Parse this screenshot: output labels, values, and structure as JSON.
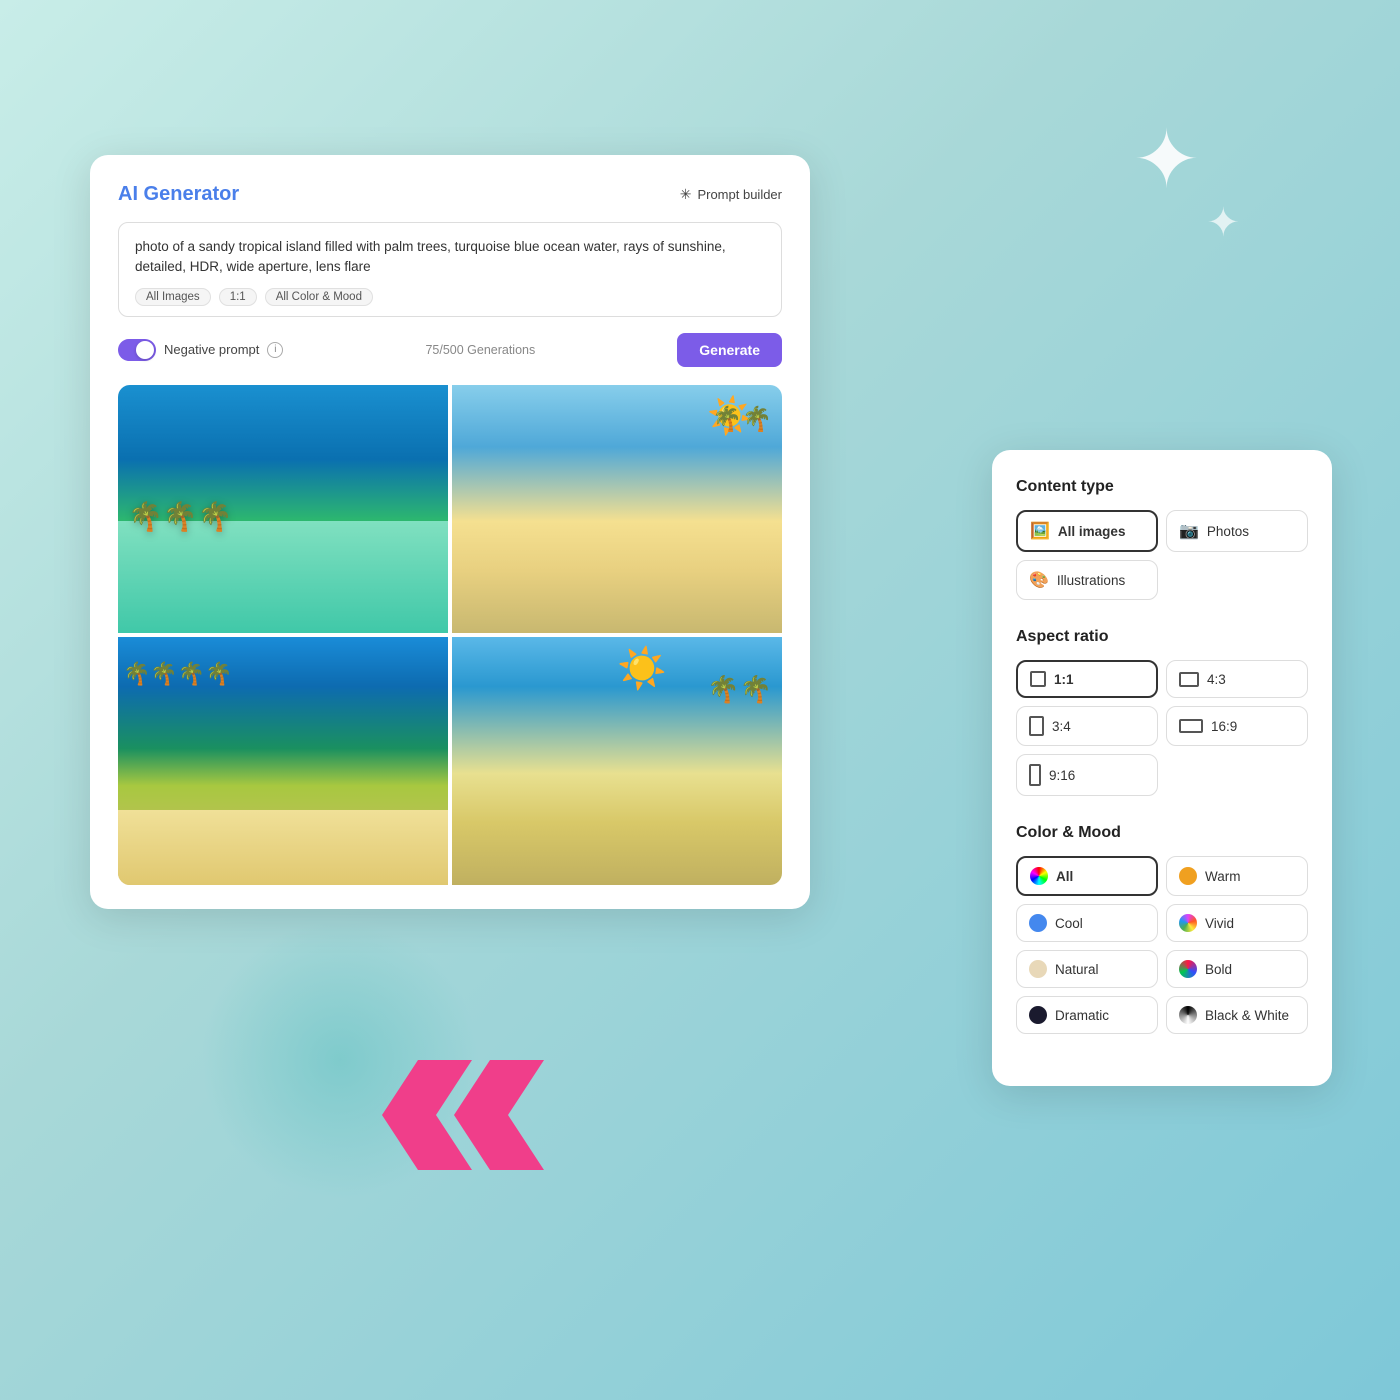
{
  "background": {
    "color_start": "#c8ede8",
    "color_end": "#7ec8d8"
  },
  "generator_card": {
    "title": "AI Generator",
    "prompt_builder_label": "Prompt builder",
    "prompt_text": "photo of a sandy tropical island filled with palm trees, turquoise blue ocean water, rays of sunshine, detailed, HDR, wide aperture, lens flare",
    "tags": [
      "All Images",
      "1:1",
      "All Color & Mood"
    ],
    "negative_prompt_label": "Negative prompt",
    "generations_text": "75/500 Generations",
    "generate_label": "Generate"
  },
  "panel": {
    "content_type": {
      "title": "Content type",
      "options": [
        {
          "label": "All images",
          "icon": "🖼️",
          "active": true
        },
        {
          "label": "Photos",
          "icon": "📷",
          "active": false
        },
        {
          "label": "Illustrations",
          "icon": "🎨",
          "active": false
        }
      ]
    },
    "aspect_ratio": {
      "title": "Aspect ratio",
      "options": [
        {
          "label": "1:1",
          "ratio": "square",
          "active": true
        },
        {
          "label": "4:3",
          "ratio": "four-three",
          "active": false
        },
        {
          "label": "3:4",
          "ratio": "three-four",
          "active": false
        },
        {
          "label": "16:9",
          "ratio": "sixteen-nine",
          "active": false
        },
        {
          "label": "9:16",
          "ratio": "nine-sixteen",
          "active": false
        }
      ]
    },
    "color_mood": {
      "title": "Color & Mood",
      "options": [
        {
          "label": "All",
          "color": "conic-gradient(red, yellow, lime, cyan, blue, magenta, red)",
          "active": true
        },
        {
          "label": "Warm",
          "color": "#f0a020"
        },
        {
          "label": "Cool",
          "color": "#4488ee"
        },
        {
          "label": "Vivid",
          "color": "conic-gradient(#e040fb, #ff5722, #ffeb3b, #4caf50, #2196f3, #e040fb)"
        },
        {
          "label": "Natural",
          "color": "#e8d8b8"
        },
        {
          "label": "Bold",
          "color": "conic-gradient(#ff1744, #304ffe, #00c853, #ff1744)"
        },
        {
          "label": "Dramatic",
          "color": "#1a1a2e"
        },
        {
          "label": "Black & White",
          "color": "conic-gradient(#000, #888, #fff, #888, #000)"
        }
      ]
    }
  }
}
